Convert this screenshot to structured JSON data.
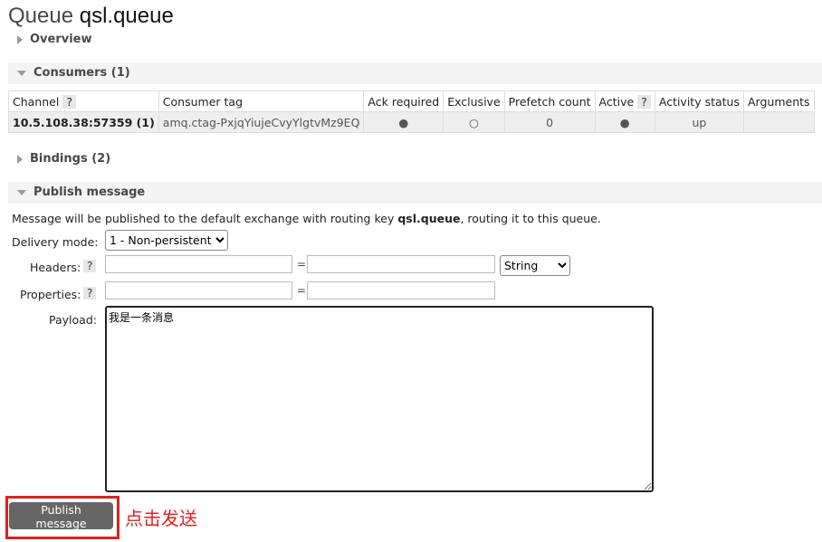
{
  "title": {
    "prefix": "Queue",
    "name": "qsl.queue"
  },
  "sections": {
    "overview": "Overview",
    "consumers": "Consumers (1)",
    "bindings": "Bindings (2)",
    "publish": "Publish message"
  },
  "consumers_table": {
    "headers": [
      "Channel",
      "Consumer tag",
      "Ack required",
      "Exclusive",
      "Prefetch count",
      "Active",
      "Activity status",
      "Arguments"
    ],
    "help": "?",
    "rows": [
      [
        "10.5.108.38:57359 (1)",
        "amq.ctag-PxjqYiujeCvyYlgtvMz9EQ",
        "●",
        "○",
        "0",
        "●",
        "up",
        ""
      ]
    ]
  },
  "publish": {
    "info_pre": "Message will be published to the default exchange with routing key ",
    "info_key": "qsl.queue",
    "info_post": ", routing it to this queue.",
    "delivery_label": "Delivery mode:",
    "delivery_value": "1 - Non-persistent",
    "headers_label": "Headers:",
    "properties_label": "Properties:",
    "eq": "=",
    "type_value": "String",
    "payload_label": "Payload:",
    "payload": "我是一条消息",
    "button": "Publish message",
    "annotation": "点击发送"
  },
  "colors": {
    "annotation": "#e02020",
    "button": "#666666"
  }
}
